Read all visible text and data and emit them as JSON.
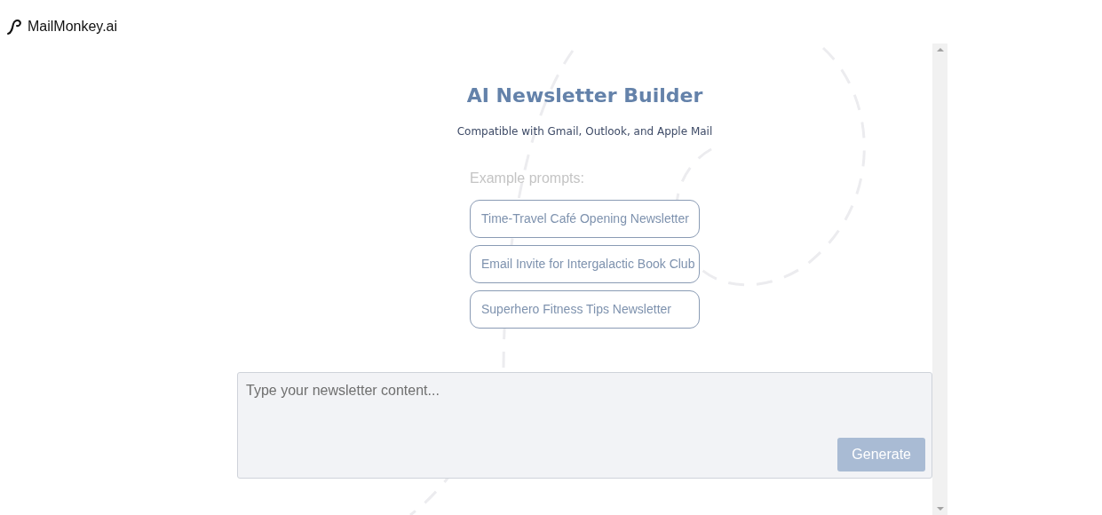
{
  "brand": {
    "name": "MailMonkey.ai"
  },
  "hero": {
    "title": "AI Newsletter Builder",
    "subtitle": "Compatible with Gmail, Outlook, and Apple Mail"
  },
  "examples": {
    "label": "Example prompts:",
    "prompts": [
      {
        "text": "Time-Travel Café Opening Newsletter"
      },
      {
        "text": "Email Invite for Intergalactic Book Club"
      },
      {
        "text": "Superhero Fitness Tips Newsletter"
      }
    ]
  },
  "composer": {
    "placeholder": "Type your newsletter content...",
    "button": {
      "label": "Generate",
      "disabled": true
    }
  }
}
